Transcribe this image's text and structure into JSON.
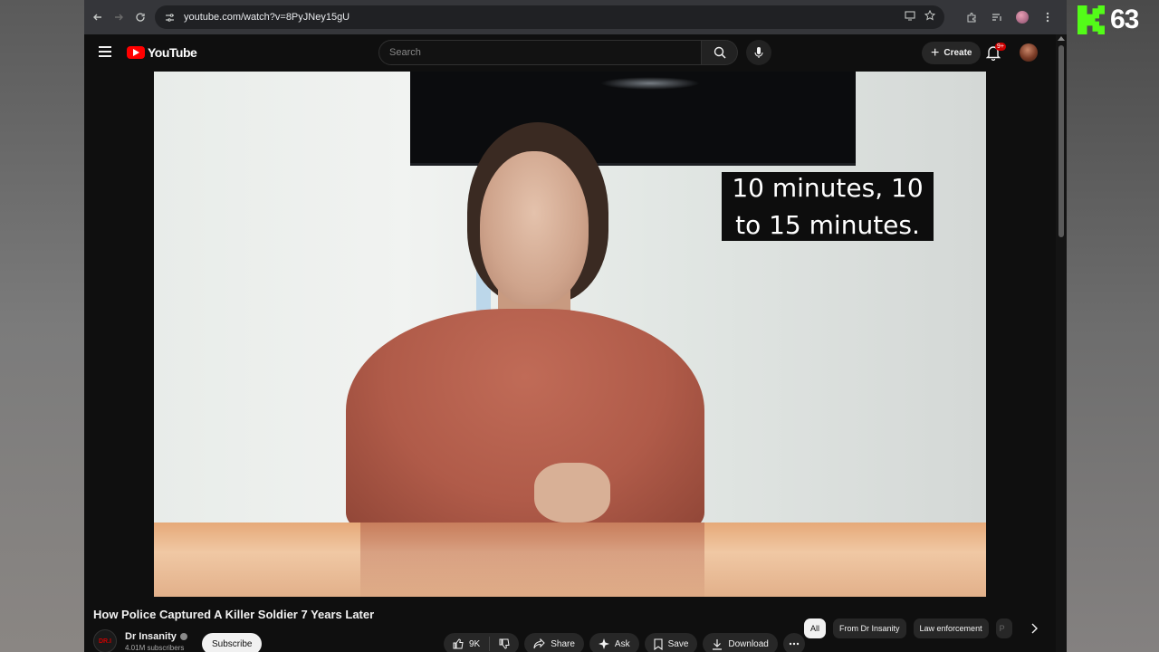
{
  "overlay": {
    "kick_count": "63",
    "accent": "#53fc18"
  },
  "browser": {
    "url": "youtube.com/watch?v=8PyJNey15gU",
    "icons": [
      "back-icon",
      "forward-icon",
      "reload-icon",
      "site-info-icon",
      "cast-icon",
      "bookmark-star-icon",
      "extensions-icon",
      "tab-search-icon",
      "profile-icon",
      "menu-icon"
    ]
  },
  "header": {
    "logo_text": "YouTube",
    "search_placeholder": "Search",
    "create_label": "Create",
    "notification_badge": "9+",
    "brand_color": "#ff0000"
  },
  "video": {
    "subtitle": "10 minutes, 10\nto 15 minutes."
  },
  "details": {
    "title": "How Police Captured A Killer Soldier 7 Years Later",
    "channel_name": "Dr Insanity",
    "channel_avatar_text": "DR.I",
    "subscribers": "4.01M subscribers",
    "subscribe_label": "Subscribe",
    "likes": "9K",
    "share_label": "Share",
    "ask_label": "Ask",
    "save_label": "Save",
    "download_label": "Download"
  },
  "chips": {
    "items": [
      "All",
      "From Dr Insanity",
      "Law enforcement",
      "P"
    ]
  }
}
